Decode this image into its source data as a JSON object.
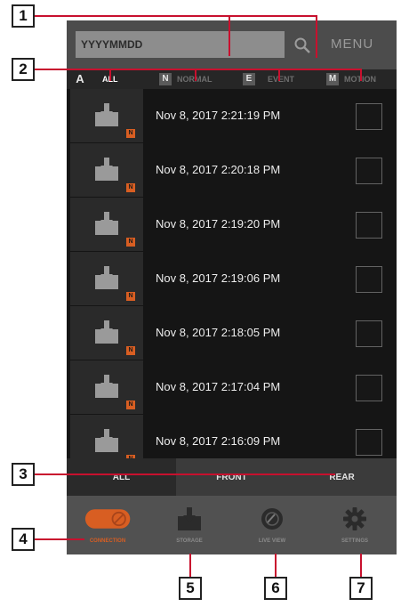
{
  "callouts": [
    "1",
    "2",
    "3",
    "4",
    "5",
    "6",
    "7"
  ],
  "search": {
    "placeholder": "YYYYMMDD"
  },
  "menu_label": "MENU",
  "filters": [
    {
      "letter": "A",
      "label": "ALL",
      "active": true
    },
    {
      "letter": "N",
      "label": "NORMAL",
      "active": false
    },
    {
      "letter": "E",
      "label": "EVENT",
      "active": false
    },
    {
      "letter": "M",
      "label": "MOTION",
      "active": false
    }
  ],
  "recordings": [
    {
      "timestamp": "Nov 8, 2017 2:21:19 PM",
      "badge": "N"
    },
    {
      "timestamp": "Nov 8, 2017 2:20:18 PM",
      "badge": "N"
    },
    {
      "timestamp": "Nov 8, 2017 2:19:20 PM",
      "badge": "N"
    },
    {
      "timestamp": "Nov 8, 2017 2:19:06 PM",
      "badge": "N"
    },
    {
      "timestamp": "Nov 8, 2017 2:18:05 PM",
      "badge": "N"
    },
    {
      "timestamp": "Nov 8, 2017 2:17:04 PM",
      "badge": "N"
    },
    {
      "timestamp": "Nov 8, 2017 2:16:09 PM",
      "badge": "N"
    }
  ],
  "camera_tabs": [
    "ALL",
    "FRONT",
    "REAR"
  ],
  "nav": [
    {
      "label": "CONNECTION",
      "icon": "connection-icon",
      "active": true
    },
    {
      "label": "STORAGE",
      "icon": "storage-icon",
      "active": false
    },
    {
      "label": "LIVE VIEW",
      "icon": "live-view-icon",
      "active": false
    },
    {
      "label": "SETTINGS",
      "icon": "settings-icon",
      "active": false
    }
  ],
  "colors": {
    "accent": "#d85e22",
    "leader": "#c8102e",
    "background": "#151515"
  }
}
